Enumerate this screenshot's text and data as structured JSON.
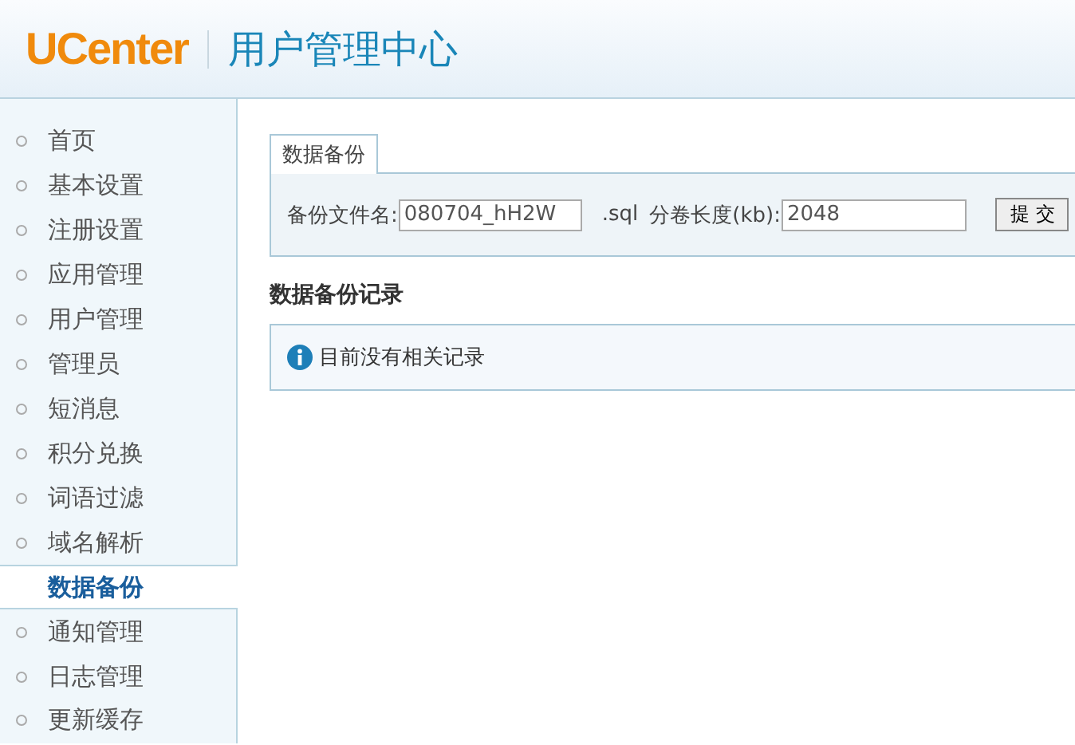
{
  "header": {
    "logo": "UCenter",
    "title": "用户管理中心"
  },
  "sidebar": {
    "items": [
      {
        "label": "首页",
        "selected": false
      },
      {
        "label": "基本设置",
        "selected": false
      },
      {
        "label": "注册设置",
        "selected": false
      },
      {
        "label": "应用管理",
        "selected": false
      },
      {
        "label": "用户管理",
        "selected": false
      },
      {
        "label": "管理员",
        "selected": false
      },
      {
        "label": "短消息",
        "selected": false
      },
      {
        "label": "积分兑换",
        "selected": false
      },
      {
        "label": "词语过滤",
        "selected": false
      },
      {
        "label": "域名解析",
        "selected": false
      },
      {
        "label": "数据备份",
        "selected": true
      },
      {
        "label": "通知管理",
        "selected": false
      },
      {
        "label": "日志管理",
        "selected": false
      },
      {
        "label": "更新缓存",
        "selected": false
      }
    ]
  },
  "backup_form": {
    "tab": "数据备份",
    "filename_label": "备份文件名:",
    "filename_value": "080704_hH2W",
    "extension": ".sql",
    "volume_label": "分卷长度(kb):",
    "volume_value": "2048",
    "submit": "提 交"
  },
  "records": {
    "heading": "数据备份记录",
    "message": "目前没有相关记录"
  }
}
